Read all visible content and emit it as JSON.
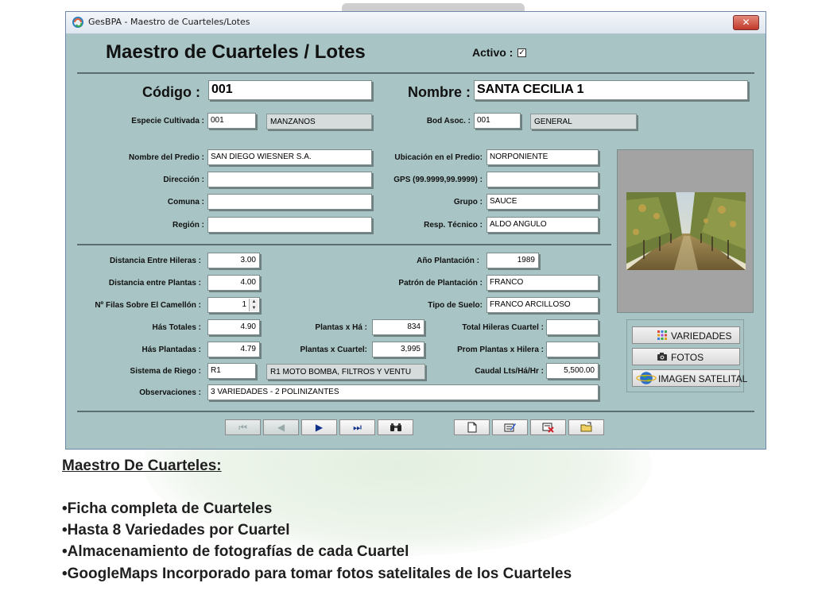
{
  "window": {
    "title": "GesBPA - Maestro de Cuarteles/Lotes",
    "close_label": "✕"
  },
  "form": {
    "title": "Maestro de Cuarteles / Lotes",
    "activo_label": "Activo :",
    "activo_checked": "✓",
    "codigo_label": "Código :",
    "codigo_value": "001",
    "nombre_label": "Nombre :",
    "nombre_value": "SANTA CECILIA 1",
    "especie_label": "Especie Cultivada :",
    "especie_code": "001",
    "especie_name": "MANZANOS",
    "bod_label": "Bod Asoc. :",
    "bod_code": "001",
    "bod_name": "GENERAL",
    "predio_label": "Nombre del Predio :",
    "predio_value": "SAN DIEGO WIESNER S.A.",
    "direccion_label": "Dirección :",
    "direccion_value": "",
    "comuna_label": "Comuna :",
    "comuna_value": "",
    "region_label": "Región :",
    "region_value": "",
    "ubicacion_label": "Ubicación en el Predio:",
    "ubicacion_value": "NORPONIENTE",
    "gps_label": "GPS (99.9999,99.9999) :",
    "gps_value": "",
    "grupo_label": "Grupo :",
    "grupo_value": "SAUCE",
    "resp_label": "Resp. Técnico :",
    "resp_value": "ALDO ANGULO",
    "dist_hileras_label": "Distancia Entre Hileras :",
    "dist_hileras_value": "3.00",
    "dist_plantas_label": "Distancia entre Plantas :",
    "dist_plantas_value": "4.00",
    "filas_label": "Nº Filas Sobre El Camellón :",
    "filas_value": "1",
    "has_totales_label": "Hás Totales :",
    "has_totales_value": "4.90",
    "has_plantadas_label": "Hás Plantadas :",
    "has_plantadas_value": "4.79",
    "riego_label": "Sistema de Riego :",
    "riego_code": "R1",
    "riego_name": "R1 MOTO BOMBA, FILTROS Y VENTU",
    "obs_label": "Observaciones :",
    "obs_value": "3 VARIEDADES - 2 POLINIZANTES",
    "plantas_ha_label": "Plantas x Há :",
    "plantas_ha_value": "834",
    "plantas_cuartel_label": "Plantas x Cuartel:",
    "plantas_cuartel_value": "3,995",
    "anio_label": "Año Plantación :",
    "anio_value": "1989",
    "patron_label": "Patrón de Plantación :",
    "patron_value": "FRANCO",
    "suelo_label": "Tipo de Suelo:",
    "suelo_value": "FRANCO ARCILLOSO",
    "total_hileras_label": "Total Hileras Cuartel :",
    "total_hileras_value": "",
    "prom_plantas_label": "Prom Plantas x Hilera :",
    "prom_plantas_value": "",
    "caudal_label": "Caudal Lts/Há/Hr :",
    "caudal_value": "5,500.00"
  },
  "side_buttons": {
    "variedades": "VARIEDADES",
    "fotos": "FOTOS",
    "imagen_satelital": "IMAGEN SATELITAL"
  },
  "nav": {
    "first": "⏮",
    "prev": "◀",
    "next": "▶",
    "last": "⏭"
  },
  "caption": {
    "heading": "Maestro De Cuarteles:",
    "bullets": [
      "•Ficha completa de Cuarteles",
      "•Hasta 8 Variedades por Cuartel",
      "•Almacenamiento de fotografías de cada Cuartel",
      "•GoogleMaps Incorporado para tomar fotos satelitales de los Cuarteles"
    ]
  },
  "colors": {
    "form_bg": "#a8c4c4",
    "background_shape": "#dcebd8"
  }
}
